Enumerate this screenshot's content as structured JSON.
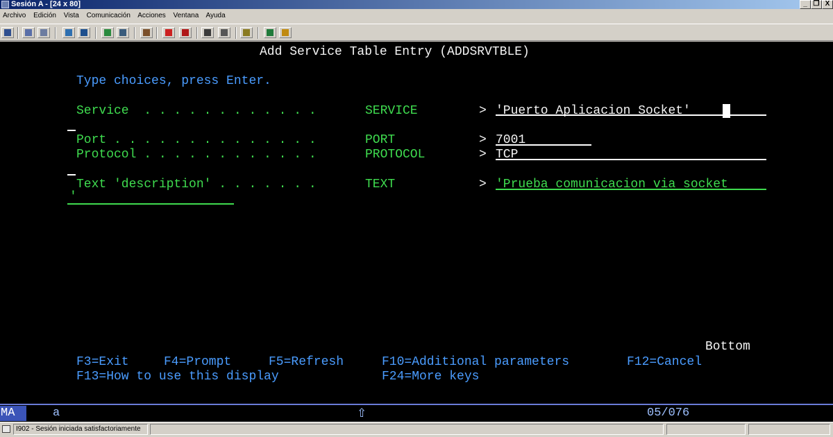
{
  "window": {
    "title": "Sesión A - [24 x 80]",
    "controls": {
      "minimize": "_",
      "restore": "❐",
      "close": "X"
    }
  },
  "menu": [
    "Archivo",
    "Edición",
    "Vista",
    "Comunicación",
    "Acciones",
    "Ventana",
    "Ayuda"
  ],
  "toolbar": {
    "buttons": [
      {
        "name": "print-screen-icon",
        "color": "#2f4f8f"
      },
      {
        "name": "copy-icon",
        "color": "#5a6fa8"
      },
      {
        "name": "paste-icon",
        "color": "#6c7ca0"
      },
      {
        "name": "send-file-icon",
        "color": "#2e6fb0"
      },
      {
        "name": "receive-file-icon",
        "color": "#1d4f8d"
      },
      {
        "name": "display-icon",
        "color": "#2a8a3e"
      },
      {
        "name": "keyboard-icon",
        "color": "#3a5c7c"
      },
      {
        "name": "chart-icon",
        "color": "#7a4f2a"
      },
      {
        "name": "record-macro-icon",
        "color": "#cc2020"
      },
      {
        "name": "stop-macro-icon",
        "color": "#b01818"
      },
      {
        "name": "play-macro-icon",
        "color": "#3b3b3b"
      },
      {
        "name": "edit-macro-icon",
        "color": "#565656"
      },
      {
        "name": "clipboard-icon",
        "color": "#8a7a20"
      },
      {
        "name": "globe-icon",
        "color": "#1f7a3a"
      },
      {
        "name": "help-icon",
        "color": "#c08a10"
      }
    ]
  },
  "screen": {
    "title": "Add Service Table Entry (ADDSRVTBLE)",
    "instruction": "Type choices, press Enter.",
    "fields": [
      {
        "label": "Service  . . . . . . . . . . . .",
        "keyword": "SERVICE",
        "marker": ">",
        "value": "'Puerto Aplicacion Socket'"
      },
      {
        "label": "Port . . . . . . . . . . . . . .",
        "keyword": "PORT",
        "marker": ">",
        "value": "7001"
      },
      {
        "label": "Protocol . . . . . . . . . . . .",
        "keyword": "PROTOCOL",
        "marker": ">",
        "value": "TCP"
      },
      {
        "label": "Text 'description' . . . . . . .",
        "keyword": "TEXT",
        "marker": ">",
        "value": "'Prueba comunicacion via socket"
      }
    ],
    "text_continuation": "'",
    "bottom": "Bottom",
    "fkeys_row1": [
      "F3=Exit",
      "F4=Prompt",
      "F5=Refresh",
      "F10=Additional parameters",
      "F12=Cancel"
    ],
    "fkeys_row2": [
      "F13=How to use this display",
      "F24=More keys"
    ]
  },
  "oia": {
    "mode": "MA",
    "indicator": "a",
    "shift_symbol": "⇧",
    "cursor_position": "05/076"
  },
  "status": {
    "message": "I902 - Sesión iniciada satisfactoriamente"
  },
  "colors": {
    "terminal_bg": "#000000",
    "label_blue": "#4a9cff",
    "text_green": "#3fdc4f",
    "input_white": "#f4f4f4",
    "oia_bar": "#3b54b8"
  }
}
